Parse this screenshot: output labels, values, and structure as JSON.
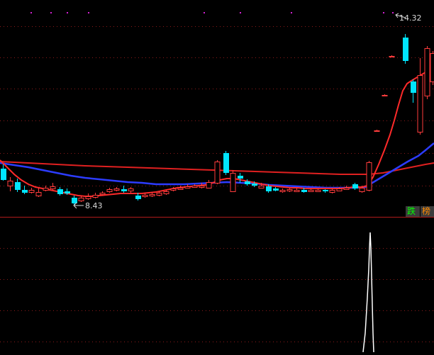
{
  "price_labels": {
    "high": "14.32",
    "low": "8.43"
  },
  "badges": {
    "fall": "跌",
    "rank": "榜"
  },
  "colors": {
    "background": "#000000",
    "grid": "#8b1a1a",
    "separator": "#b01a1a",
    "up_candle": "#ff3c3c",
    "down_candle": "#00e5ff",
    "ma_short": "#ff2a2a",
    "ma_mid": "#2c3cff",
    "ma_long": "#e02020",
    "indicator": "#ffffff",
    "marker": "#d020d0"
  },
  "chart_data": {
    "type": "candlestick",
    "high_price": 14.32,
    "low_price": 8.43,
    "panels": [
      "price",
      "indicator"
    ]
  }
}
